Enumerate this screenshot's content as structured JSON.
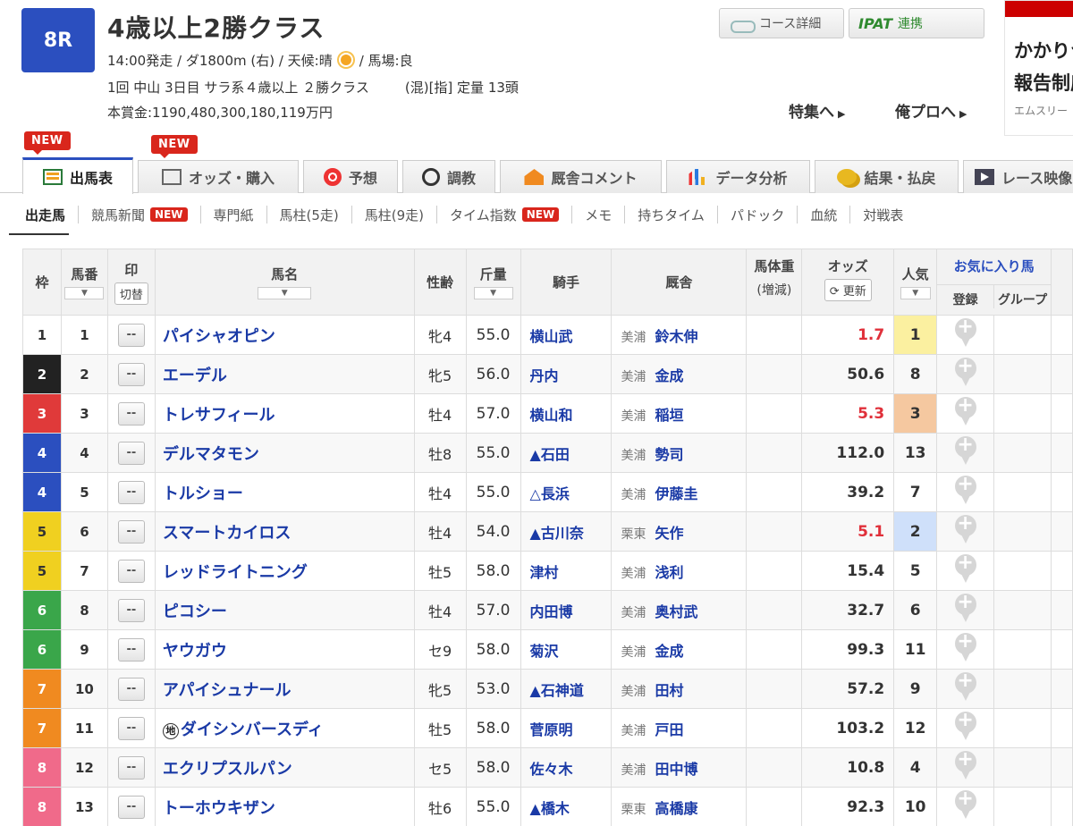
{
  "race": {
    "number": "8R",
    "title": "4歳以上2勝クラス",
    "info1_a": "14:00発走 / ダ1800m (右) / 天候:晴",
    "info1_b": "/ 馬場:良",
    "info2_a": "1回 中山 3日目 サラ系４歳以上 ２勝クラス",
    "info2_b": "(混)[指] 定量 13頭",
    "prize": "本賞金:1190,480,300,180,119万円"
  },
  "header_buttons": {
    "course": "コース詳細",
    "ipat_logo": "IPAT",
    "ipat_label": "連携",
    "tokushu": "特集へ",
    "orepro": "俺プロへ"
  },
  "ad": {
    "line1": "かかりつけ",
    "line2": "報告制度",
    "line3": "エムスリー"
  },
  "main_tabs": [
    {
      "label": "出馬表",
      "icon": "table-icon"
    },
    {
      "label": "オッズ・購入",
      "icon": "odds-icon"
    },
    {
      "label": "予想",
      "icon": "target-icon"
    },
    {
      "label": "調教",
      "icon": "stopwatch-icon"
    },
    {
      "label": "厩舎コメント",
      "icon": "stable-icon"
    },
    {
      "label": "データ分析",
      "icon": "bar-chart-icon"
    },
    {
      "label": "結果・払戻",
      "icon": "coins-icon"
    },
    {
      "label": "レース映像",
      "icon": "video-icon"
    }
  ],
  "new_label": "NEW",
  "sub_nav": [
    {
      "label": "出走馬",
      "new": false
    },
    {
      "label": "競馬新聞",
      "new": true
    },
    {
      "label": "専門紙",
      "new": false
    },
    {
      "label": "馬柱(5走)",
      "new": false
    },
    {
      "label": "馬柱(9走)",
      "new": false
    },
    {
      "label": "タイム指数",
      "new": true
    },
    {
      "label": "メモ",
      "new": false
    },
    {
      "label": "持ちタイム",
      "new": false
    },
    {
      "label": "パドック",
      "new": false
    },
    {
      "label": "血統",
      "new": false
    },
    {
      "label": "対戦表",
      "new": false
    }
  ],
  "table_headers": {
    "waku": "枠",
    "umaban": "馬番",
    "mark": "印",
    "mark_btn": "切替",
    "name": "馬名",
    "seirei": "性齢",
    "kinryo": "斤量",
    "jockey": "騎手",
    "stable": "厩舎",
    "weight": "馬体重",
    "weight_sub": "(増減)",
    "odds": "オッズ",
    "odds_btn": "更新",
    "ninki": "人気",
    "fav": "お気に入り馬",
    "fav_reg": "登録",
    "fav_group": "グループ"
  },
  "mark_placeholder": "--",
  "waku_colors": {
    "1": "#ffffff",
    "2": "#222222",
    "3": "#e03a3a",
    "4": "#2b4fbf",
    "5": "#f0d020",
    "6": "#3aa64a",
    "7": "#f08a20",
    "8": "#f06a8a"
  },
  "horses": [
    {
      "waku": "1",
      "umaban": "1",
      "name": "パイシャオピン",
      "chi": false,
      "seirei": "牝4",
      "kinryo": "55.0",
      "jockey": "横山武",
      "area": "美浦",
      "trainer": "鈴木伸",
      "odds": "1.7",
      "hot": true,
      "ninki": "1",
      "ninki_color": "#fbf0a0"
    },
    {
      "waku": "2",
      "umaban": "2",
      "name": "エーデル",
      "chi": false,
      "seirei": "牝5",
      "kinryo": "56.0",
      "jockey": "丹内",
      "area": "美浦",
      "trainer": "金成",
      "odds": "50.6",
      "hot": false,
      "ninki": "8",
      "ninki_color": ""
    },
    {
      "waku": "3",
      "umaban": "3",
      "name": "トレサフィール",
      "chi": false,
      "seirei": "牡4",
      "kinryo": "57.0",
      "jockey": "横山和",
      "area": "美浦",
      "trainer": "稲垣",
      "odds": "5.3",
      "hot": true,
      "ninki": "3",
      "ninki_color": "#f5c8a0"
    },
    {
      "waku": "4",
      "umaban": "4",
      "name": "デルマタモン",
      "chi": false,
      "seirei": "牡8",
      "kinryo": "55.0",
      "jockey": "▲石田",
      "area": "美浦",
      "trainer": "勢司",
      "odds": "112.0",
      "hot": false,
      "ninki": "13",
      "ninki_color": ""
    },
    {
      "waku": "4",
      "umaban": "5",
      "name": "トルショー",
      "chi": false,
      "seirei": "牡4",
      "kinryo": "55.0",
      "jockey": "△長浜",
      "area": "美浦",
      "trainer": "伊藤圭",
      "odds": "39.2",
      "hot": false,
      "ninki": "7",
      "ninki_color": ""
    },
    {
      "waku": "5",
      "umaban": "6",
      "name": "スマートカイロス",
      "chi": false,
      "seirei": "牡4",
      "kinryo": "54.0",
      "jockey": "▲古川奈",
      "area": "栗東",
      "trainer": "矢作",
      "odds": "5.1",
      "hot": true,
      "ninki": "2",
      "ninki_color": "#cfe0fa"
    },
    {
      "waku": "5",
      "umaban": "7",
      "name": "レッドライトニング",
      "chi": false,
      "seirei": "牡5",
      "kinryo": "58.0",
      "jockey": "津村",
      "area": "美浦",
      "trainer": "浅利",
      "odds": "15.4",
      "hot": false,
      "ninki": "5",
      "ninki_color": ""
    },
    {
      "waku": "6",
      "umaban": "8",
      "name": "ピコシー",
      "chi": false,
      "seirei": "牡4",
      "kinryo": "57.0",
      "jockey": "内田博",
      "area": "美浦",
      "trainer": "奥村武",
      "odds": "32.7",
      "hot": false,
      "ninki": "6",
      "ninki_color": ""
    },
    {
      "waku": "6",
      "umaban": "9",
      "name": "ヤウガウ",
      "chi": false,
      "seirei": "セ9",
      "kinryo": "58.0",
      "jockey": "菊沢",
      "area": "美浦",
      "trainer": "金成",
      "odds": "99.3",
      "hot": false,
      "ninki": "11",
      "ninki_color": ""
    },
    {
      "waku": "7",
      "umaban": "10",
      "name": "アパイシュナール",
      "chi": false,
      "seirei": "牝5",
      "kinryo": "53.0",
      "jockey": "▲石神道",
      "area": "美浦",
      "trainer": "田村",
      "odds": "57.2",
      "hot": false,
      "ninki": "9",
      "ninki_color": ""
    },
    {
      "waku": "7",
      "umaban": "11",
      "name": "ダイシンバースディ",
      "chi": true,
      "chi_label": "地",
      "seirei": "牡5",
      "kinryo": "58.0",
      "jockey": "菅原明",
      "area": "美浦",
      "trainer": "戸田",
      "odds": "103.2",
      "hot": false,
      "ninki": "12",
      "ninki_color": ""
    },
    {
      "waku": "8",
      "umaban": "12",
      "name": "エクリプスルパン",
      "chi": false,
      "seirei": "セ5",
      "kinryo": "58.0",
      "jockey": "佐々木",
      "area": "美浦",
      "trainer": "田中博",
      "odds": "10.8",
      "hot": false,
      "ninki": "4",
      "ninki_color": ""
    },
    {
      "waku": "8",
      "umaban": "13",
      "name": "トーホウキザン",
      "chi": false,
      "seirei": "牡6",
      "kinryo": "55.0",
      "jockey": "▲橋木",
      "area": "栗東",
      "trainer": "高橋康",
      "odds": "92.3",
      "hot": false,
      "ninki": "10",
      "ninki_color": ""
    }
  ]
}
